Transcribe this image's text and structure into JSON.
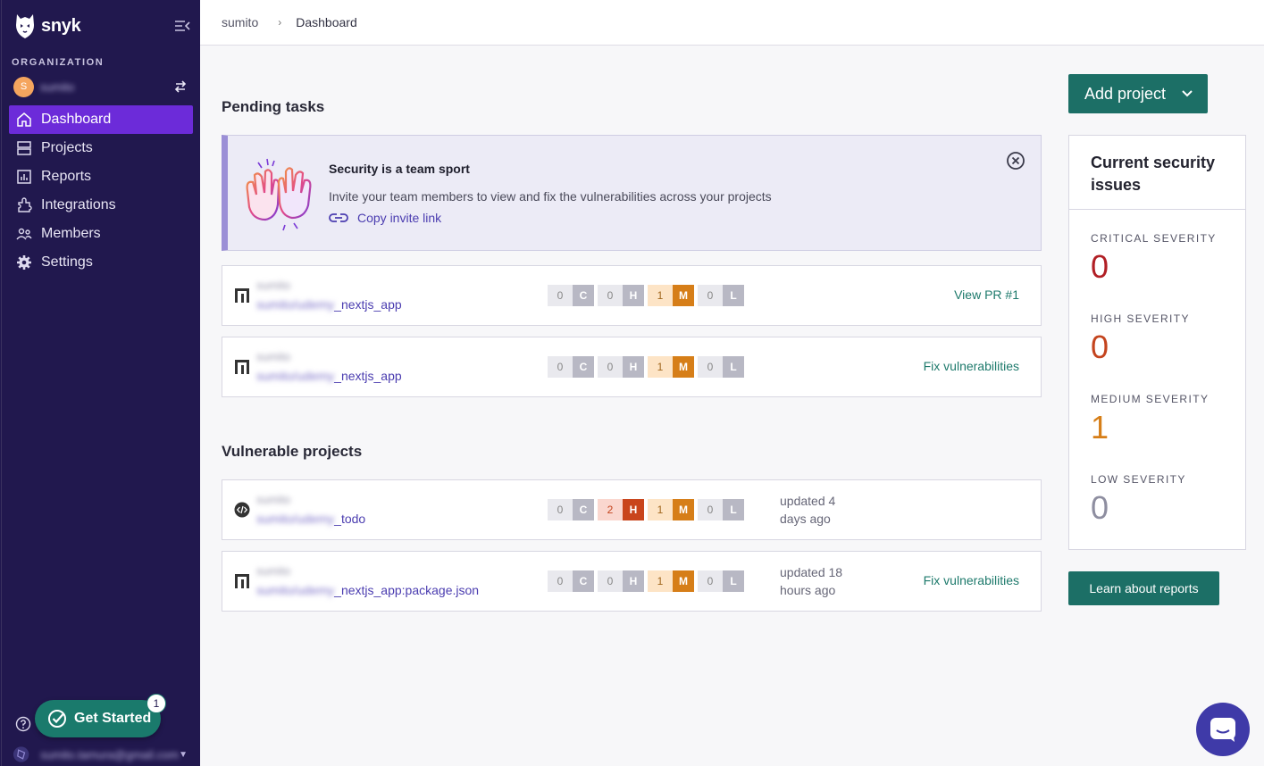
{
  "app": {
    "logo_text": "snyk"
  },
  "sidebar": {
    "org_label": "ORGANIZATION",
    "org_avatar": "S",
    "org_name": "sumito",
    "items": [
      {
        "label": "Dashboard",
        "icon": "home-icon",
        "active": true
      },
      {
        "label": "Projects",
        "icon": "projects-icon",
        "active": false
      },
      {
        "label": "Reports",
        "icon": "reports-icon",
        "active": false
      },
      {
        "label": "Integrations",
        "icon": "integrations-icon",
        "active": false
      },
      {
        "label": "Members",
        "icon": "members-icon",
        "active": false
      },
      {
        "label": "Settings",
        "icon": "gear-icon",
        "active": false
      }
    ],
    "get_started_label": "Get Started",
    "get_started_badge": "1",
    "user_name": "sumito.tamura@gmail.com"
  },
  "breadcrumb": {
    "org": "sumito",
    "current": "Dashboard"
  },
  "pending": {
    "title": "Pending tasks",
    "banner": {
      "title": "Security is a team sport",
      "text": "Invite your team members to view and fix the vulnerabilities across your projects",
      "link": "Copy invite link"
    },
    "rows": [
      {
        "org": "sumito",
        "name_prefix": "sumito/udemy",
        "name_suffix": "_nextjs_app",
        "counts": [
          "0",
          "0",
          "1",
          "0"
        ],
        "action": "View PR #1"
      },
      {
        "org": "sumito",
        "name_prefix": "sumito/udemy",
        "name_suffix": "_nextjs_app",
        "counts": [
          "0",
          "0",
          "1",
          "0"
        ],
        "action": "Fix vulnerabilities"
      }
    ]
  },
  "vulnerable": {
    "title": "Vulnerable projects",
    "rows": [
      {
        "org": "sumito",
        "name_prefix": "sumito/udemy",
        "name_suffix": "_todo",
        "counts": [
          "0",
          "2",
          "1",
          "0"
        ],
        "updated_1": "updated 4",
        "updated_2": "days ago",
        "action": ""
      },
      {
        "org": "sumito",
        "name_prefix": "sumito/udemy",
        "name_suffix": "_nextjs_app:package.json",
        "counts": [
          "0",
          "0",
          "1",
          "0"
        ],
        "updated_1": "updated 18",
        "updated_2": "hours ago",
        "action": "Fix vulnerabilities"
      }
    ]
  },
  "severity_letters": [
    "C",
    "H",
    "M",
    "L"
  ],
  "right": {
    "add_project": "Add project",
    "issues_title": "Current security issues",
    "critical_label": "CRITICAL SEVERITY",
    "critical_value": "0",
    "high_label": "HIGH SEVERITY",
    "high_value": "0",
    "medium_label": "MEDIUM SEVERITY",
    "medium_value": "1",
    "low_label": "LOW SEVERITY",
    "low_value": "0",
    "learn_button": "Learn about reports"
  },
  "colors": {
    "sidebar_bg": "#21184e",
    "active_nav": "#6c2bd9",
    "primary_button": "#1c6f66",
    "critical": "#b11f25",
    "high": "#c4441e",
    "medium": "#d67e18",
    "low": "#8e8ea0"
  }
}
